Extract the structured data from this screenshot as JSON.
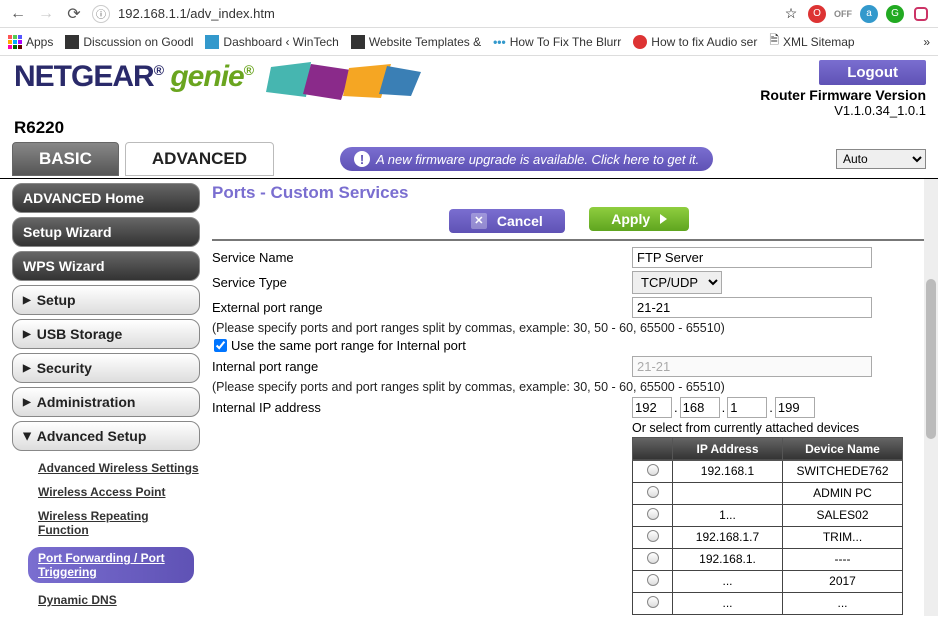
{
  "browser": {
    "url": "192.168.1.1/adv_index.htm",
    "bookmarks": [
      "Apps",
      "Discussion on Goodl",
      "Dashboard ‹ WinTech",
      "Website Templates &",
      "How To Fix The Blurr",
      "How to fix Audio ser",
      "XML Sitemap"
    ]
  },
  "header": {
    "brand_net": "NETGEAR",
    "brand_genie": "genie",
    "model": "R6220",
    "logout": "Logout",
    "fw_label": "Router Firmware Version",
    "fw_version": "V1.1.0.34_1.0.1"
  },
  "tabs": {
    "basic": "BASIC",
    "advanced": "ADVANCED"
  },
  "fw_msg": "A new firmware upgrade is available. Click here to get it.",
  "lang": "Auto",
  "sidebar": {
    "adv_home": "ADVANCED Home",
    "setup_wiz": "Setup Wizard",
    "wps_wiz": "WPS Wizard",
    "items": [
      "Setup",
      "USB Storage",
      "Security",
      "Administration",
      "Advanced Setup"
    ],
    "adv_sub": [
      "Advanced Wireless Settings",
      "Wireless Access Point",
      "Wireless Repeating Function",
      "Port Forwarding / Port Triggering",
      "Dynamic DNS"
    ]
  },
  "page": {
    "title": "Ports - Custom Services",
    "cancel": "Cancel",
    "apply": "Apply",
    "labels": {
      "service_name": "Service Name",
      "service_type": "Service Type",
      "ext_range": "External port range",
      "hint": "(Please specify ports and port ranges split by commas, example: 30, 50 - 60, 65500 - 65510)",
      "same_chk": "Use the same port range for Internal port",
      "int_range": "Internal port range",
      "int_ip": "Internal IP address",
      "or_select": "Or select from currently attached devices"
    },
    "values": {
      "service_name": "FTP Server",
      "service_type": "TCP/UDP",
      "ext_range": "21-21",
      "int_range": "21-21",
      "ip": [
        "192",
        "168",
        "1",
        "199"
      ]
    },
    "table": {
      "h_ip": "IP Address",
      "h_dev": "Device Name",
      "rows": [
        {
          "ip": "192.168.1",
          "dev": "SWITCHEDE762"
        },
        {
          "ip": "",
          "dev": "ADMIN PC"
        },
        {
          "ip": "1...",
          "dev": "SALES02"
        },
        {
          "ip": "192.168.1.7",
          "dev": "TRIM..."
        },
        {
          "ip": "192.168.1.",
          "dev": "----"
        },
        {
          "ip": "...",
          "dev": "2017"
        },
        {
          "ip": "...",
          "dev": "..."
        }
      ]
    }
  }
}
